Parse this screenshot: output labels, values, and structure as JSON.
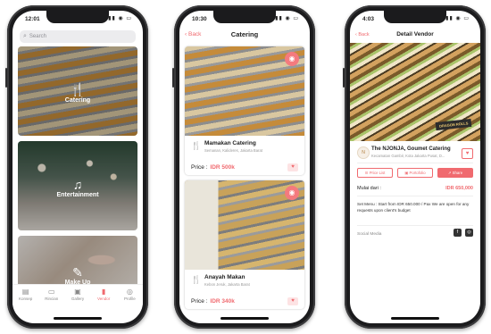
{
  "phone1": {
    "status_time": "12:01",
    "status_icons": "▮▮ ◉ ▭",
    "search_placeholder": "Search",
    "categories": [
      {
        "label": "Catering",
        "icon": "utensils-icon",
        "glyph": "🍴"
      },
      {
        "label": "Entertainment",
        "icon": "entertainment-icon",
        "glyph": "♫"
      },
      {
        "label": "Make Up",
        "icon": "makeup-icon",
        "glyph": "✎"
      }
    ],
    "tabs": [
      {
        "label": "Konsep",
        "glyph": "▤"
      },
      {
        "label": "Rincian",
        "glyph": "▭"
      },
      {
        "label": "Gallery",
        "glyph": "▣"
      },
      {
        "label": "Vendor",
        "glyph": "▮"
      },
      {
        "label": "Profile",
        "glyph": "◎"
      }
    ],
    "active_tab": "Vendor"
  },
  "phone2": {
    "status_time": "10:30",
    "status_icons": "▮▮ ◉ ▭",
    "back_label": "Back",
    "title": "Catering",
    "listings": [
      {
        "name": "Mamakan Catering",
        "address": "Semanan, Kalideres, Jakarta Barat",
        "price_label": "Price :",
        "price": "IDR 500k"
      },
      {
        "name": "Anayah Makan",
        "address": "Kebon Jeruk, Jakarta Barat",
        "price_label": "Price :",
        "price": "IDR 340k"
      }
    ]
  },
  "phone3": {
    "status_time": "4:03",
    "status_icons": "▮▮ ◉ ▭",
    "back_label": "Back",
    "title": "Detail Vendor",
    "hero_sign": "DRAGON ROLLS",
    "vendor_name": "The NJONJA, Goumet Catering",
    "vendor_address": "Kecamatan Gambir, Kota Jakarta Pusat, D...",
    "buttons": [
      "Price List",
      "Portofolio",
      "Share"
    ],
    "mulai_label": "Mulai dari :",
    "mulai_value": "IDR 650,000",
    "set_menu": "Set Menu :  Start from IDR 650.000 / Pax  We are open for any requests upon client's budget",
    "social_label": "Social Media"
  },
  "colors": {
    "accent": "#f06a6f",
    "frame": "#1b1b1d"
  }
}
